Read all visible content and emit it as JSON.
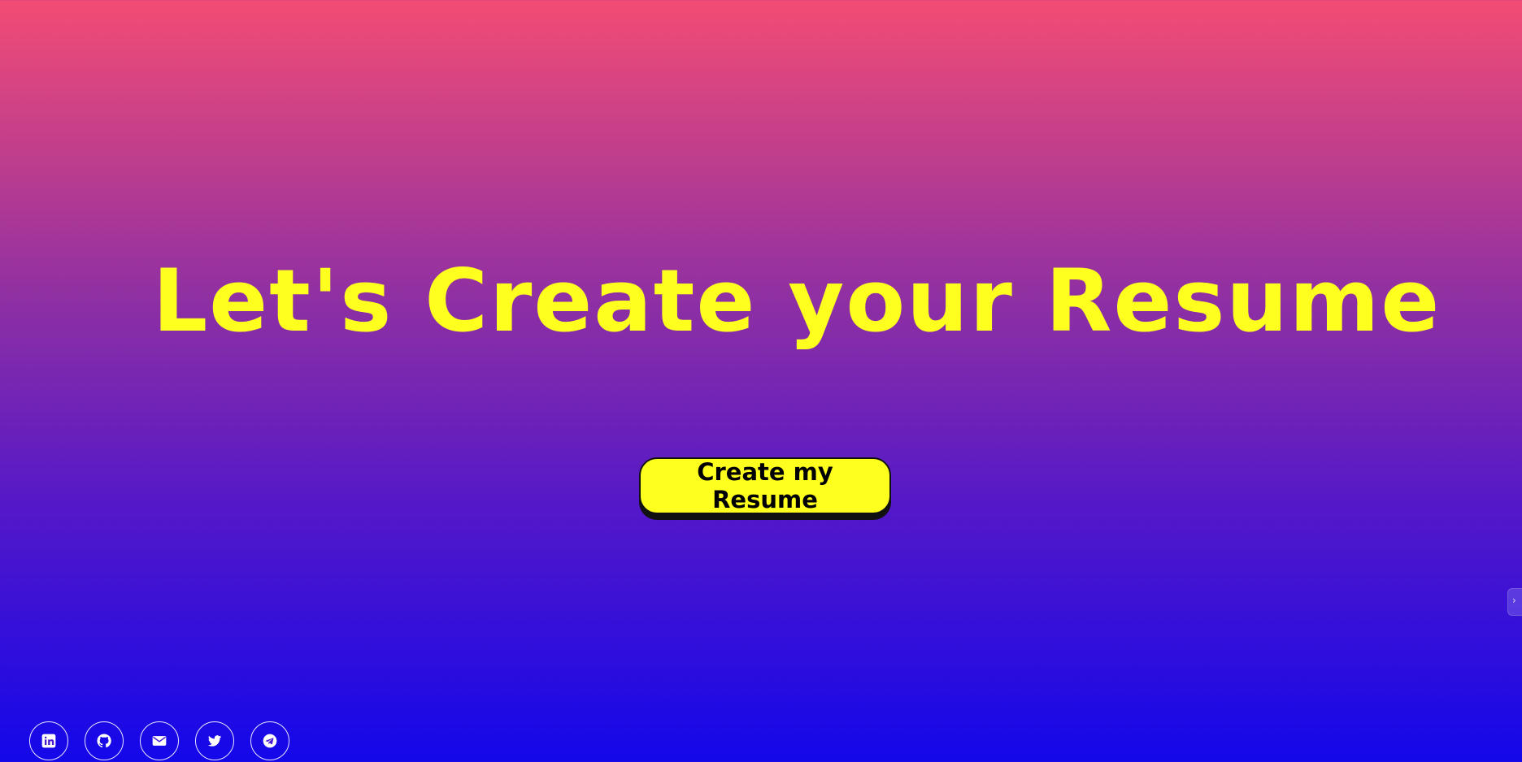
{
  "hero": {
    "title": "Let's Create your Resume",
    "button_label": "Create my Resume"
  },
  "social": [
    {
      "name": "linkedin",
      "icon": "linkedin-icon"
    },
    {
      "name": "github",
      "icon": "github-icon"
    },
    {
      "name": "email",
      "icon": "mail-icon"
    },
    {
      "name": "twitter",
      "icon": "twitter-icon"
    },
    {
      "name": "telegram",
      "icon": "telegram-icon"
    }
  ],
  "side_handle": {
    "icon": "chevron-icon",
    "glyph": "›"
  },
  "colors": {
    "accent": "#ffff1f",
    "gradient_top": "#f34c74",
    "gradient_bottom": "#1307ea"
  }
}
